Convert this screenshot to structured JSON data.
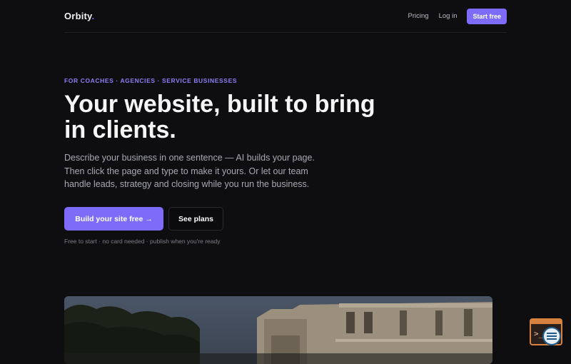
{
  "nav": {
    "logo_text": "Orbity",
    "logo_dot": ".",
    "links": [
      "Pricing",
      "Log in"
    ],
    "cta": "Start free"
  },
  "hero": {
    "eyebrow": "FOR COACHES · AGENCIES · SERVICE BUSINESSES",
    "headline": "Your website, built to bring in clients.",
    "lead": "Describe your business in one sentence — AI builds your page. Then click the page and type to make it yours. Or let our team handle leads, strategy and closing while you run the business.",
    "primary_cta": "Build your site free →",
    "secondary_cta": "See plans",
    "fineprint": "Free to start · no card needed · publish when you're ready"
  },
  "colors": {
    "background": "#0e0e11",
    "accent": "#7c6cf7",
    "text": "#f5f5f5",
    "muted": "#a8a8b3"
  },
  "icons": {
    "widget": "chat-assistant-icon"
  }
}
